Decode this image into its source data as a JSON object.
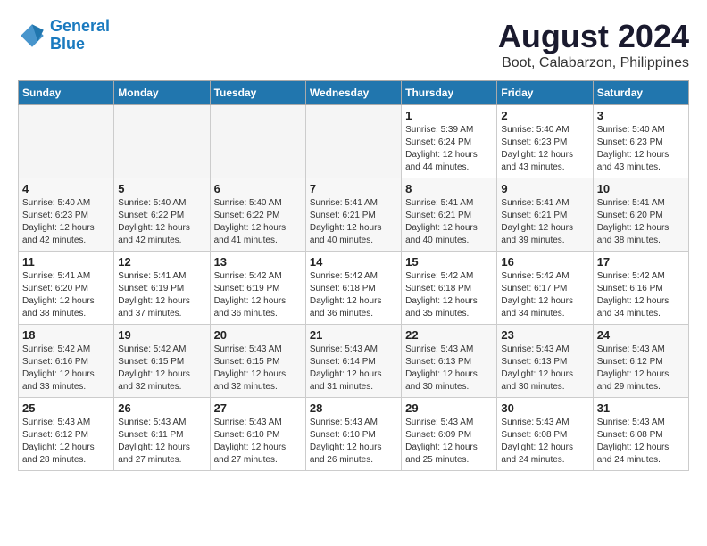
{
  "logo": {
    "line1": "General",
    "line2": "Blue"
  },
  "title": "August 2024",
  "subtitle": "Boot, Calabarzon, Philippines",
  "days_of_week": [
    "Sunday",
    "Monday",
    "Tuesday",
    "Wednesday",
    "Thursday",
    "Friday",
    "Saturday"
  ],
  "weeks": [
    [
      {
        "num": "",
        "info": "",
        "empty": true
      },
      {
        "num": "",
        "info": "",
        "empty": true
      },
      {
        "num": "",
        "info": "",
        "empty": true
      },
      {
        "num": "",
        "info": "",
        "empty": true
      },
      {
        "num": "1",
        "info": "Sunrise: 5:39 AM\nSunset: 6:24 PM\nDaylight: 12 hours\nand 44 minutes."
      },
      {
        "num": "2",
        "info": "Sunrise: 5:40 AM\nSunset: 6:23 PM\nDaylight: 12 hours\nand 43 minutes."
      },
      {
        "num": "3",
        "info": "Sunrise: 5:40 AM\nSunset: 6:23 PM\nDaylight: 12 hours\nand 43 minutes."
      }
    ],
    [
      {
        "num": "4",
        "info": "Sunrise: 5:40 AM\nSunset: 6:23 PM\nDaylight: 12 hours\nand 42 minutes."
      },
      {
        "num": "5",
        "info": "Sunrise: 5:40 AM\nSunset: 6:22 PM\nDaylight: 12 hours\nand 42 minutes."
      },
      {
        "num": "6",
        "info": "Sunrise: 5:40 AM\nSunset: 6:22 PM\nDaylight: 12 hours\nand 41 minutes."
      },
      {
        "num": "7",
        "info": "Sunrise: 5:41 AM\nSunset: 6:21 PM\nDaylight: 12 hours\nand 40 minutes."
      },
      {
        "num": "8",
        "info": "Sunrise: 5:41 AM\nSunset: 6:21 PM\nDaylight: 12 hours\nand 40 minutes."
      },
      {
        "num": "9",
        "info": "Sunrise: 5:41 AM\nSunset: 6:21 PM\nDaylight: 12 hours\nand 39 minutes."
      },
      {
        "num": "10",
        "info": "Sunrise: 5:41 AM\nSunset: 6:20 PM\nDaylight: 12 hours\nand 38 minutes."
      }
    ],
    [
      {
        "num": "11",
        "info": "Sunrise: 5:41 AM\nSunset: 6:20 PM\nDaylight: 12 hours\nand 38 minutes."
      },
      {
        "num": "12",
        "info": "Sunrise: 5:41 AM\nSunset: 6:19 PM\nDaylight: 12 hours\nand 37 minutes."
      },
      {
        "num": "13",
        "info": "Sunrise: 5:42 AM\nSunset: 6:19 PM\nDaylight: 12 hours\nand 36 minutes."
      },
      {
        "num": "14",
        "info": "Sunrise: 5:42 AM\nSunset: 6:18 PM\nDaylight: 12 hours\nand 36 minutes."
      },
      {
        "num": "15",
        "info": "Sunrise: 5:42 AM\nSunset: 6:18 PM\nDaylight: 12 hours\nand 35 minutes."
      },
      {
        "num": "16",
        "info": "Sunrise: 5:42 AM\nSunset: 6:17 PM\nDaylight: 12 hours\nand 34 minutes."
      },
      {
        "num": "17",
        "info": "Sunrise: 5:42 AM\nSunset: 6:16 PM\nDaylight: 12 hours\nand 34 minutes."
      }
    ],
    [
      {
        "num": "18",
        "info": "Sunrise: 5:42 AM\nSunset: 6:16 PM\nDaylight: 12 hours\nand 33 minutes."
      },
      {
        "num": "19",
        "info": "Sunrise: 5:42 AM\nSunset: 6:15 PM\nDaylight: 12 hours\nand 32 minutes."
      },
      {
        "num": "20",
        "info": "Sunrise: 5:43 AM\nSunset: 6:15 PM\nDaylight: 12 hours\nand 32 minutes."
      },
      {
        "num": "21",
        "info": "Sunrise: 5:43 AM\nSunset: 6:14 PM\nDaylight: 12 hours\nand 31 minutes."
      },
      {
        "num": "22",
        "info": "Sunrise: 5:43 AM\nSunset: 6:13 PM\nDaylight: 12 hours\nand 30 minutes."
      },
      {
        "num": "23",
        "info": "Sunrise: 5:43 AM\nSunset: 6:13 PM\nDaylight: 12 hours\nand 30 minutes."
      },
      {
        "num": "24",
        "info": "Sunrise: 5:43 AM\nSunset: 6:12 PM\nDaylight: 12 hours\nand 29 minutes."
      }
    ],
    [
      {
        "num": "25",
        "info": "Sunrise: 5:43 AM\nSunset: 6:12 PM\nDaylight: 12 hours\nand 28 minutes."
      },
      {
        "num": "26",
        "info": "Sunrise: 5:43 AM\nSunset: 6:11 PM\nDaylight: 12 hours\nand 27 minutes."
      },
      {
        "num": "27",
        "info": "Sunrise: 5:43 AM\nSunset: 6:10 PM\nDaylight: 12 hours\nand 27 minutes."
      },
      {
        "num": "28",
        "info": "Sunrise: 5:43 AM\nSunset: 6:10 PM\nDaylight: 12 hours\nand 26 minutes."
      },
      {
        "num": "29",
        "info": "Sunrise: 5:43 AM\nSunset: 6:09 PM\nDaylight: 12 hours\nand 25 minutes."
      },
      {
        "num": "30",
        "info": "Sunrise: 5:43 AM\nSunset: 6:08 PM\nDaylight: 12 hours\nand 24 minutes."
      },
      {
        "num": "31",
        "info": "Sunrise: 5:43 AM\nSunset: 6:08 PM\nDaylight: 12 hours\nand 24 minutes."
      }
    ]
  ]
}
